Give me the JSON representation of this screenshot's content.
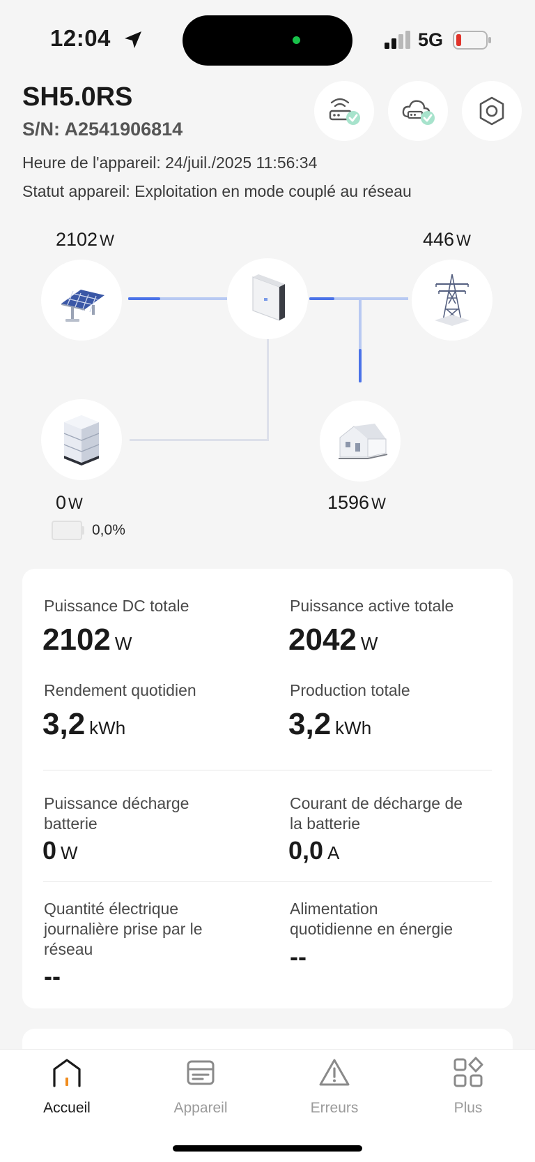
{
  "status_bar": {
    "time": "12:04",
    "network": "5G",
    "icons": [
      "location-arrow-icon",
      "signal-icon",
      "battery-low-icon"
    ],
    "battery_color": "#e0342b"
  },
  "device": {
    "model": "SH5.0RS",
    "serial": "S/N: A2541906814",
    "time_line": "Heure de l'appareil: 24/juil./2025 11:56:34",
    "status_line": "Statut appareil: Exploitation en mode couplé au réseau"
  },
  "header_buttons": [
    "wifi-connected-icon",
    "cloud-connected-icon",
    "settings-gear-icon"
  ],
  "flow": {
    "pv": {
      "value": "2102",
      "unit": "W",
      "icon": "solar-panel-icon"
    },
    "grid": {
      "value": "446",
      "unit": "W",
      "icon": "power-pylon-icon"
    },
    "inverter": {
      "icon": "inverter-icon"
    },
    "battery": {
      "value": "0",
      "unit": "W",
      "icon": "battery-stack-icon",
      "soc": "0,0%"
    },
    "load": {
      "value": "1596",
      "unit": "W",
      "icon": "house-icon"
    },
    "line_color": "#dde0ea",
    "active_color": "#4a72e8"
  },
  "stats": {
    "dc_power": {
      "label": "Puissance DC totale",
      "value": "2102",
      "unit": "W"
    },
    "active_power": {
      "label": "Puissance active totale",
      "value": "2042",
      "unit": "W"
    },
    "daily_yield": {
      "label": "Rendement quotidien",
      "value": "3,2",
      "unit": "kWh"
    },
    "total_production": {
      "label": "Production totale",
      "value": "3,2",
      "unit": "kWh"
    },
    "battery_discharge_power": {
      "label_1": "Puissance décharge",
      "label_2": "batterie",
      "value": "0",
      "unit": "W"
    },
    "battery_discharge_current": {
      "label_1": "Courant de décharge de",
      "label_2": "la batterie",
      "value": "0,0",
      "unit": "A"
    },
    "daily_grid_import": {
      "label_1": "Quantité électrique",
      "label_2": "journalière prise par le",
      "label_3": "réseau",
      "value": "--"
    },
    "daily_energy_supply": {
      "label_1": "Alimentation",
      "label_2": "quotidienne en énergie",
      "value": "--"
    }
  },
  "nav": {
    "items": [
      {
        "label": "Accueil",
        "icon": "home-icon",
        "active": true
      },
      {
        "label": "Appareil",
        "icon": "device-icon",
        "active": false
      },
      {
        "label": "Erreurs",
        "icon": "warning-icon",
        "active": false
      },
      {
        "label": "Plus",
        "icon": "more-grid-icon",
        "active": false
      }
    ],
    "accent": "#f08c1e"
  }
}
